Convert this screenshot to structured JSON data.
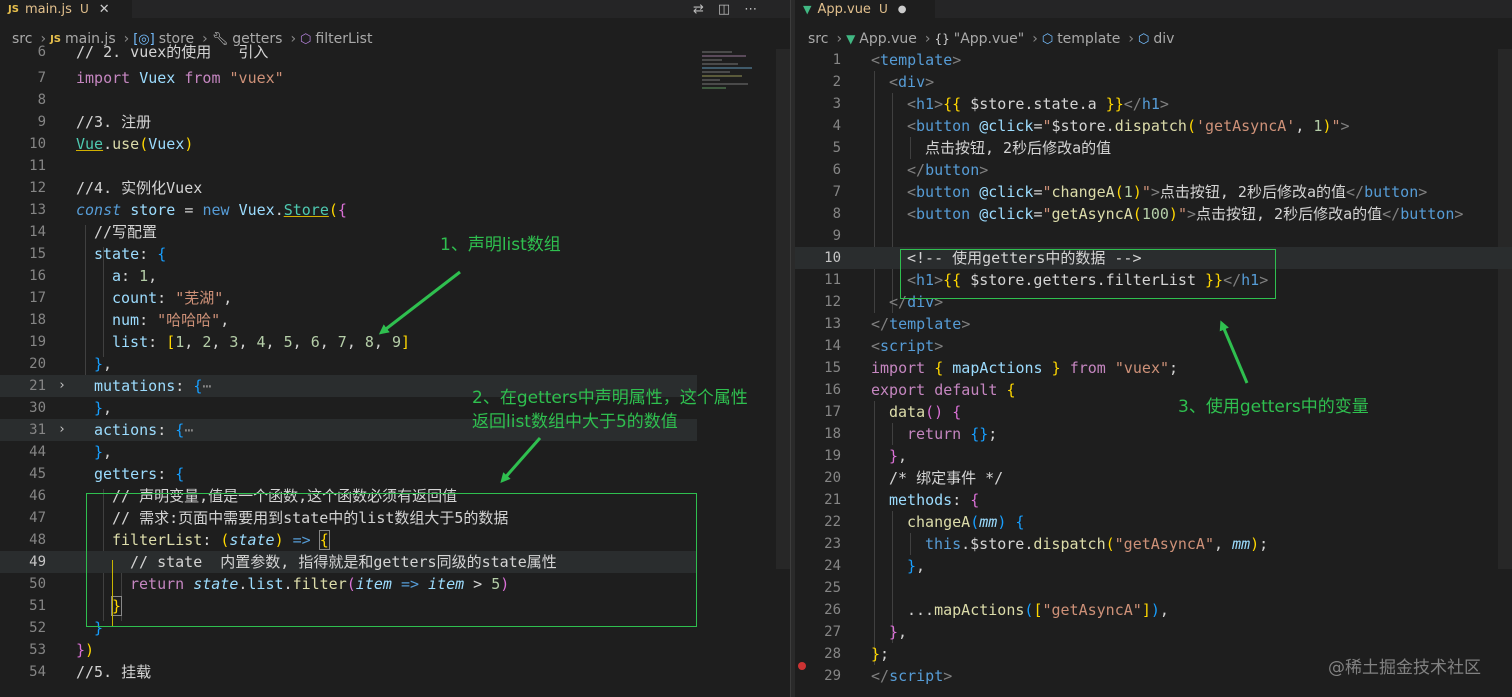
{
  "left": {
    "tab": {
      "icon": "JS",
      "name": "main.js",
      "status": "U",
      "close": "✕"
    },
    "breadcrumb": [
      "src",
      "main.js",
      "store",
      "getters",
      "filterList"
    ]
  },
  "right": {
    "tab": {
      "icon": "vue-icon",
      "name": "App.vue",
      "status": "U",
      "dot": "●"
    },
    "breadcrumb": [
      "src",
      "App.vue",
      "\"App.vue\"",
      "template",
      "div"
    ]
  },
  "annotations": {
    "a1": "1、声明list数组",
    "a2_line1": "2、在getters中声明属性，这个属性",
    "a2_line2": "返回list数组中大于5的数值",
    "a3": "3、使用getters中的变量"
  },
  "watermark": "@稀土掘金技术社区",
  "colors": {
    "annotation": "#2fbf4f",
    "background": "#1e1e1e"
  }
}
